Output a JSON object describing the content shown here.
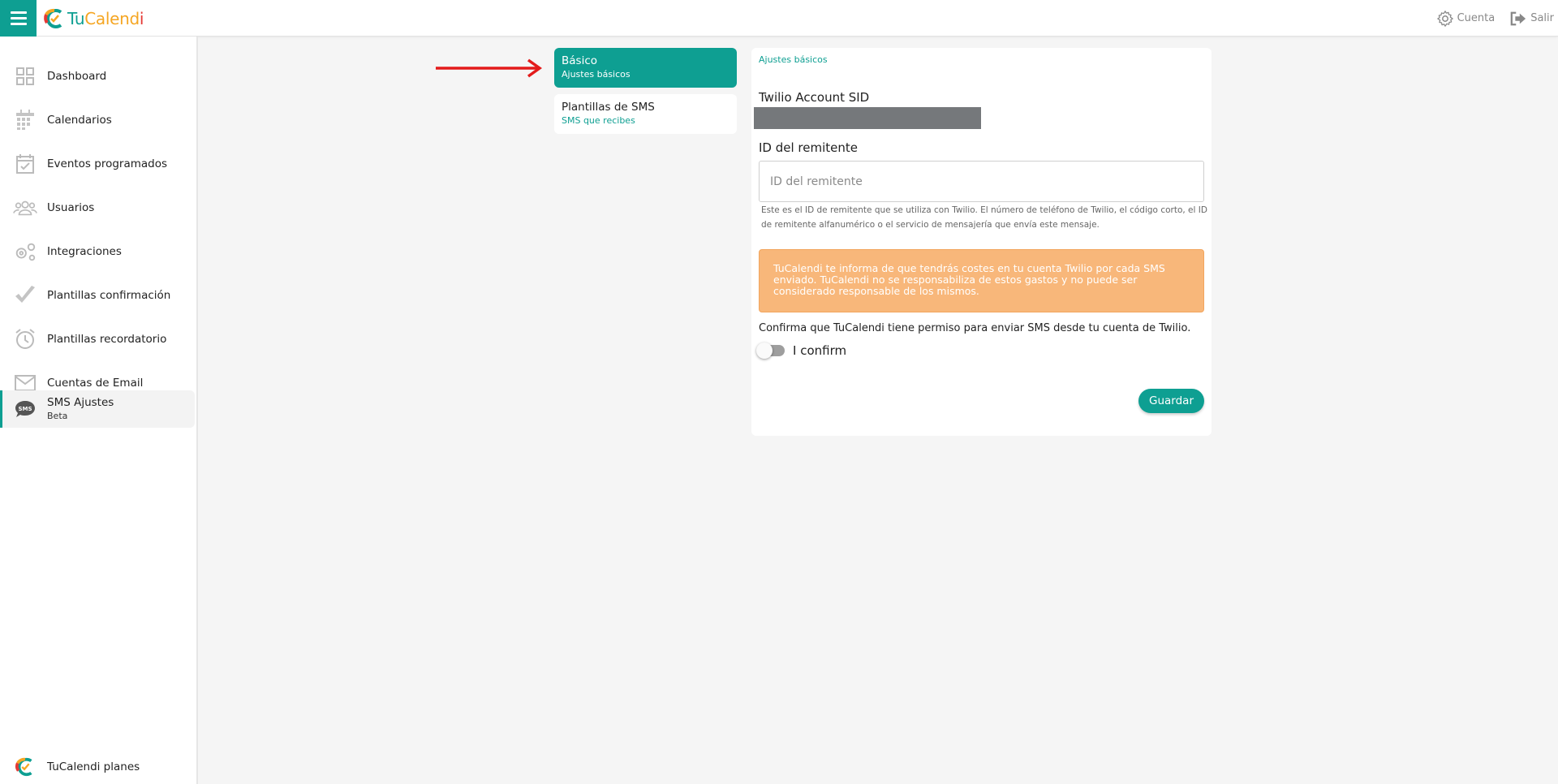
{
  "app": {
    "brand_tu": "Tu",
    "brand_cal": "Calend",
    "brand_i": "i"
  },
  "topbar": {
    "account_label": "Cuenta",
    "logout_label": "Salir"
  },
  "sidebar": {
    "items": [
      {
        "label": "Dashboard",
        "icon": "dashboard-icon"
      },
      {
        "label": "Calendarios",
        "icon": "calendar-icon"
      },
      {
        "label": "Eventos programados",
        "icon": "calendar-check-icon"
      },
      {
        "label": "Usuarios",
        "icon": "users-icon"
      },
      {
        "label": "Integraciones",
        "icon": "gears-icon"
      },
      {
        "label": "Plantillas confirmación",
        "icon": "check-icon"
      },
      {
        "label": "Plantillas recordatorio",
        "icon": "alarm-clock-icon"
      },
      {
        "label": "Cuentas de Email",
        "icon": "envelope-icon"
      },
      {
        "label": "SMS Ajustes",
        "sub": "Beta",
        "icon": "sms-bubble-icon",
        "active": true
      }
    ],
    "plans_label": "TuCalendi planes"
  },
  "submenu": [
    {
      "title": "Básico",
      "subtitle": "Ajustes básicos",
      "active": true
    },
    {
      "title": "Plantillas de SMS",
      "subtitle": "SMS que recibes",
      "active": false
    }
  ],
  "form": {
    "breadcrumb": "Ajustes básicos",
    "sid_label": "Twilio Account SID",
    "sender_label": "ID del remitente",
    "sender_placeholder": "ID del remitente",
    "sender_value": "",
    "help_text": "Este es el ID de remitente que se utiliza con Twilio. El número de teléfono de Twilio, el código corto, el ID de remitente alfanumérico o el servicio de mensajería que envía este mensaje.",
    "warning_text": "TuCalendi te informa de que tendrás costes en tu cuenta Twilio por cada SMS enviado. TuCalendi no se responsabiliza de estos gastos y no puede ser considerado responsable de los mismos.",
    "confirm_text": "Confirma que TuCalendi tiene permiso para enviar SMS desde tu cuenta de Twilio.",
    "toggle_label": "I confirm",
    "toggle_on": false,
    "save_label": "Guardar"
  },
  "colors": {
    "accent": "#0e9f92",
    "warning_bg": "#f8b77a",
    "arrow": "#e31b1b"
  }
}
